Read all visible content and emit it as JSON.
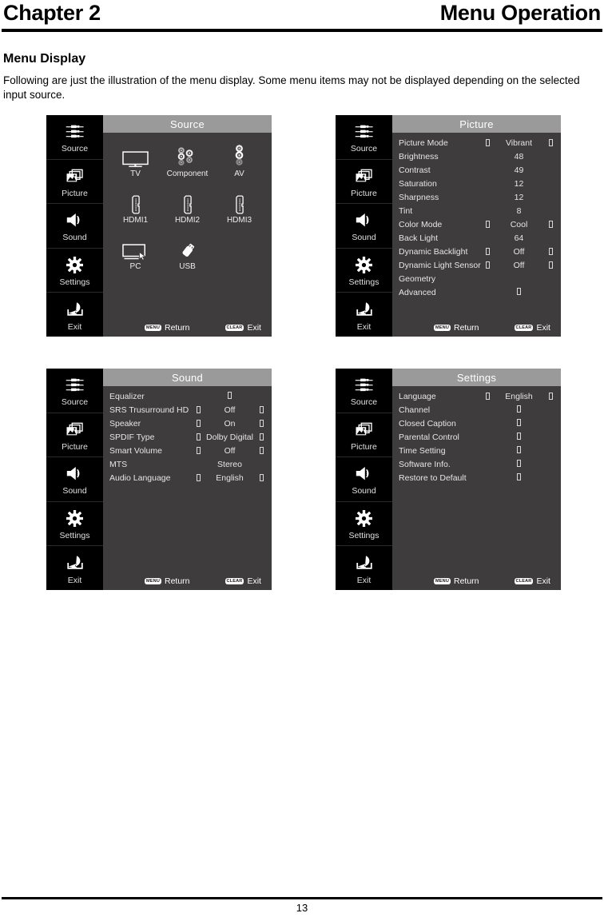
{
  "page": {
    "chapter": "Chapter 2",
    "section": "Menu Operation",
    "heading": "Menu Display",
    "paragraph": "Following are just the illustration of the menu display. Some menu items may not be displayed depending on the selected input source.",
    "page_number": "13"
  },
  "sidebar": {
    "items": [
      {
        "label": "Source",
        "icon": "av-jacks-icon"
      },
      {
        "label": "Picture",
        "icon": "photos-icon"
      },
      {
        "label": "Sound",
        "icon": "speaker-icon"
      },
      {
        "label": "Settings",
        "icon": "gear-icon"
      },
      {
        "label": "Exit",
        "icon": "exit-arrow-icon"
      }
    ]
  },
  "footer": {
    "menu_key": "MENU",
    "return_label": "Return",
    "clear_key": "CLEAR",
    "exit_label": "Exit"
  },
  "menus": {
    "source": {
      "title": "Source",
      "sources": [
        {
          "label": "TV",
          "icon": "tv-icon"
        },
        {
          "label": "Component",
          "icon": "component-jacks-icon"
        },
        {
          "label": "AV",
          "icon": "av-jacks-icon"
        },
        {
          "label": "HDMI1",
          "icon": "hdmi-port-icon"
        },
        {
          "label": "HDMI2",
          "icon": "hdmi-port-icon"
        },
        {
          "label": "HDMI3",
          "icon": "hdmi-port-icon"
        },
        {
          "label": "PC",
          "icon": "pc-monitor-icon"
        },
        {
          "label": "USB",
          "icon": "usb-stick-icon"
        }
      ]
    },
    "picture": {
      "title": "Picture",
      "rows": [
        {
          "label": "Picture Mode",
          "value": "Vibrant",
          "arrows": true
        },
        {
          "label": "Brightness",
          "value": "48",
          "arrows": false
        },
        {
          "label": "Contrast",
          "value": "49",
          "arrows": false
        },
        {
          "label": "Saturation",
          "value": "12",
          "arrows": false
        },
        {
          "label": "Sharpness",
          "value": "12",
          "arrows": false
        },
        {
          "label": "Tint",
          "value": "8",
          "arrows": false
        },
        {
          "label": "Color Mode",
          "value": "Cool",
          "arrows": true
        },
        {
          "label": "Back Light",
          "value": "64",
          "arrows": false
        },
        {
          "label": "Dynamic Backlight",
          "value": "Off",
          "arrows": true
        },
        {
          "label": "Dynamic Light Sensor",
          "value": "Off",
          "arrows": true
        },
        {
          "label": "Geometry",
          "value": "",
          "arrows": false
        },
        {
          "label": "Advanced",
          "value": "□",
          "arrows": false,
          "submenu": true
        }
      ]
    },
    "sound": {
      "title": "Sound",
      "rows": [
        {
          "label": "Equalizer",
          "value": "□",
          "arrows": false,
          "submenu": true
        },
        {
          "label": "SRS Trusurround HD",
          "value": "Off",
          "arrows": true
        },
        {
          "label": "Speaker",
          "value": "On",
          "arrows": true
        },
        {
          "label": "SPDIF Type",
          "value": "Dolby Digital",
          "arrows": true
        },
        {
          "label": "Smart Volume",
          "value": "Off",
          "arrows": true
        },
        {
          "label": "MTS",
          "value": "Stereo",
          "arrows": false
        },
        {
          "label": "Audio Language",
          "value": "English",
          "arrows": true
        }
      ]
    },
    "settings": {
      "title": "Settings",
      "rows": [
        {
          "label": "Language",
          "value": "English",
          "arrows": true
        },
        {
          "label": "Channel",
          "value": "□",
          "arrows": false,
          "submenu": true
        },
        {
          "label": "Closed Caption",
          "value": "□",
          "arrows": false,
          "submenu": true
        },
        {
          "label": "Parental Control",
          "value": "□",
          "arrows": false,
          "submenu": true
        },
        {
          "label": "Time Setting",
          "value": "□",
          "arrows": false,
          "submenu": true
        },
        {
          "label": "Software Info.",
          "value": "□",
          "arrows": false,
          "submenu": true
        },
        {
          "label": "Restore to Default",
          "value": "□",
          "arrows": false,
          "submenu": true
        }
      ]
    }
  },
  "colors": {
    "panel_bg": "#3e3c3c",
    "sidebar_bg": "#000000",
    "title_bar_bg": "#9a9a9a",
    "text": "#e6e6e6"
  }
}
